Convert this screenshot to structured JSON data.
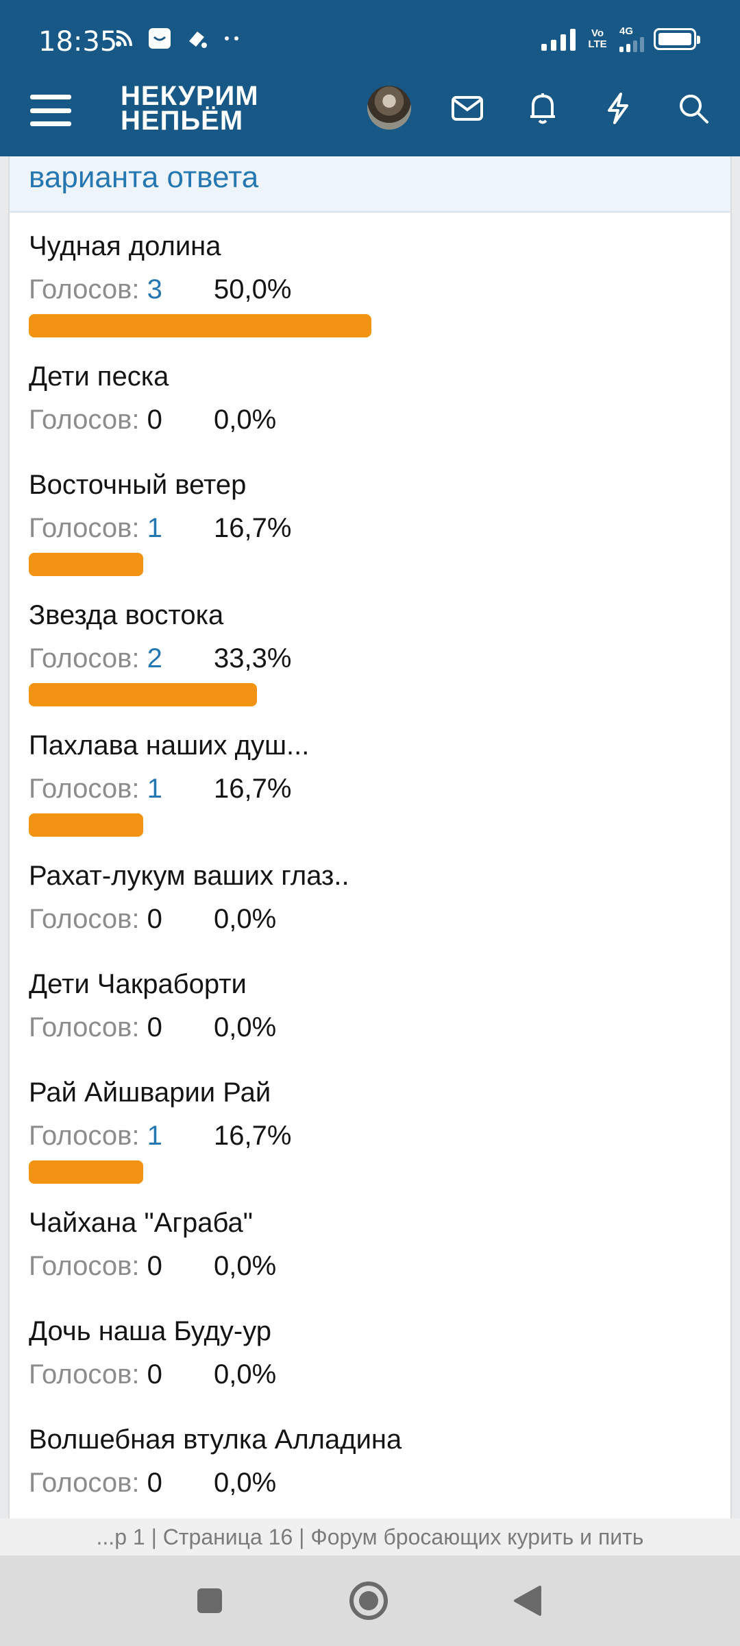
{
  "status_bar": {
    "time": "18:35",
    "volte": "Vo LTE",
    "network": "4G"
  },
  "app_bar": {
    "logo_line1": "НЕКУРИМ",
    "logo_line2": "НЕПЬЁМ"
  },
  "poll": {
    "header_text": "варианта ответа",
    "votes_label": "Голосов: ",
    "options": [
      {
        "label": "Чудная долина",
        "votes": "3",
        "percent": "50,0%",
        "share": 0.5
      },
      {
        "label": "Дети песка",
        "votes": "0",
        "percent": "0,0%",
        "share": 0
      },
      {
        "label": "Восточный ветер",
        "votes": "1",
        "percent": "16,7%",
        "share": 0.167
      },
      {
        "label": "Звезда востока",
        "votes": "2",
        "percent": "33,3%",
        "share": 0.333
      },
      {
        "label": "Пахлава наших душ...",
        "votes": "1",
        "percent": "16,7%",
        "share": 0.167
      },
      {
        "label": "Рахат-лукум ваших глаз..",
        "votes": "0",
        "percent": "0,0%",
        "share": 0
      },
      {
        "label": "Дети Чакраборти",
        "votes": "0",
        "percent": "0,0%",
        "share": 0
      },
      {
        "label": "Рай Айшварии Рай",
        "votes": "1",
        "percent": "16,7%",
        "share": 0.167
      },
      {
        "label": "Чайхана \"Аграба\"",
        "votes": "0",
        "percent": "0,0%",
        "share": 0
      },
      {
        "label": "Дочь наша Буду-ур",
        "votes": "0",
        "percent": "0,0%",
        "share": 0
      },
      {
        "label": "Волшебная втулка Алладина",
        "votes": "0",
        "percent": "0,0%",
        "share": 0
      }
    ]
  },
  "footer": {
    "page_title": "...р 1 | Страница 16 | Форум бросающих курить и пить"
  },
  "colors": {
    "header_bg": "#185886",
    "bar": "#f39314",
    "link": "#2577b1"
  },
  "icons": [
    "menu-icon",
    "avatar",
    "mail-icon",
    "bell-icon",
    "lightning-icon",
    "search-icon",
    "square-icon",
    "home-circle-icon",
    "back-triangle-icon"
  ]
}
